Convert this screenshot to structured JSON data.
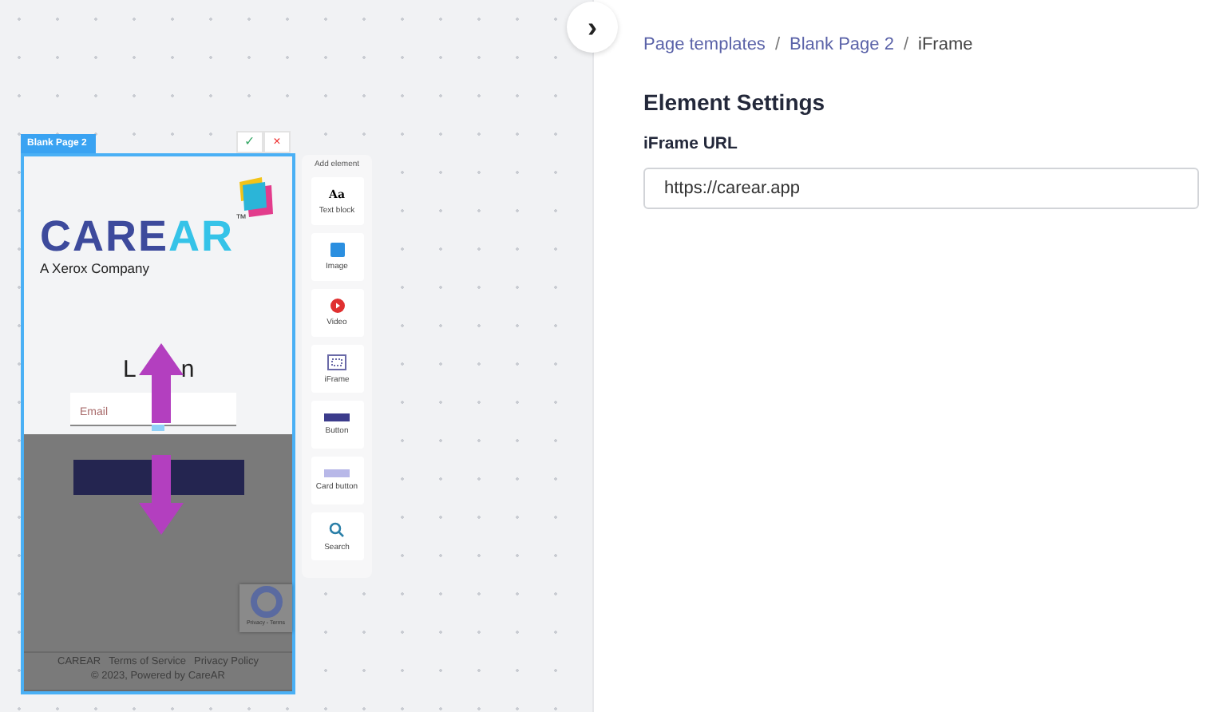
{
  "frame": {
    "tab": "Blank Page 2",
    "confirm": "✓",
    "cancel": "×",
    "preview": {
      "logo_first": "CARE",
      "logo_second": "AR",
      "trademark": "™",
      "tagline": "A Xerox Company",
      "heading_parts": [
        "L",
        "n"
      ],
      "email_placeholder": "Email",
      "recaptcha": "Privacy - Terms",
      "footer_links": [
        "CAREAR",
        "Terms of Service",
        "Privacy Policy"
      ],
      "copyright": "© 2023, Powered by CareAR"
    }
  },
  "palette": {
    "title": "Add element",
    "items": [
      {
        "kind": "text",
        "label": "Text block",
        "glyph": "Aa"
      },
      {
        "kind": "image",
        "label": "Image"
      },
      {
        "kind": "video",
        "label": "Video"
      },
      {
        "kind": "iframe",
        "label": "iFrame"
      },
      {
        "kind": "button",
        "label": "Button"
      },
      {
        "kind": "card",
        "label": "Card button"
      },
      {
        "kind": "search",
        "label": "Search"
      }
    ]
  },
  "collapse": "›",
  "breadcrumb": [
    {
      "label": "Page templates",
      "link": true
    },
    {
      "label": "Blank Page 2",
      "link": true
    },
    {
      "label": "iFrame",
      "link": false
    }
  ],
  "separator": "/",
  "settings": {
    "title": "Element Settings",
    "field_label": "iFrame URL",
    "field_value": "https://carear.app"
  }
}
